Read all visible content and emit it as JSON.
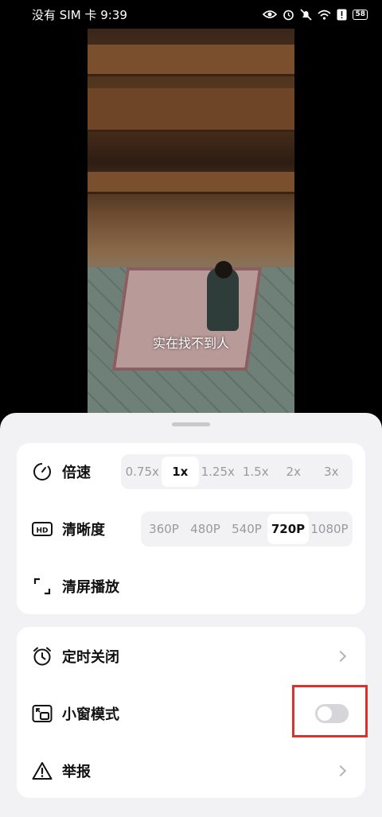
{
  "status_bar": {
    "carrier_time": "没有 SIM 卡 9:39",
    "battery": "58"
  },
  "video": {
    "subtitle": "实在找不到人"
  },
  "panel": {
    "speed": {
      "label": "倍速",
      "options": [
        "0.75x",
        "1x",
        "1.25x",
        "1.5x",
        "2x",
        "3x"
      ],
      "selected": "1x"
    },
    "quality": {
      "label": "清晰度",
      "options": [
        "360P",
        "480P",
        "540P",
        "720P",
        "1080P"
      ],
      "selected": "720P"
    },
    "clear_screen": {
      "label": "清屏播放"
    },
    "timer_close": {
      "label": "定时关闭"
    },
    "mini_window": {
      "label": "小窗模式",
      "enabled": false
    },
    "report": {
      "label": "举报"
    }
  },
  "colors": {
    "highlight": "#d9342b",
    "sheet_bg": "#f2f2f4"
  }
}
